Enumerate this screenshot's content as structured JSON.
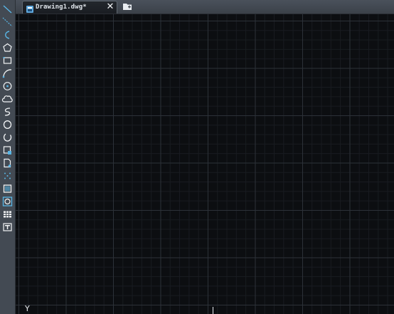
{
  "document_tab": {
    "label": "Drawing1.dwg*",
    "close_glyph": "✕",
    "icon": "dwg-file-icon"
  },
  "tab_bar": {
    "menu_icon": "chevron-down-icon",
    "new_tab_icon": "new-drawing-icon"
  },
  "tool_palette": {
    "items": [
      {
        "name": "line-tool",
        "icon": "line-icon"
      },
      {
        "name": "construction-line-tool",
        "icon": "xline-icon"
      },
      {
        "name": "polyline-tool",
        "icon": "polyline-icon"
      },
      {
        "name": "polygon-tool",
        "icon": "polygon-icon"
      },
      {
        "name": "rectangle-tool",
        "icon": "rectangle-icon"
      },
      {
        "name": "arc-tool",
        "icon": "arc-icon"
      },
      {
        "name": "circle-tool",
        "icon": "circle-icon"
      },
      {
        "name": "revision-cloud-tool",
        "icon": "cloud-icon"
      },
      {
        "name": "spline-tool",
        "icon": "spline-icon"
      },
      {
        "name": "ellipse-tool",
        "icon": "ellipse-icon"
      },
      {
        "name": "ellipse-arc-tool",
        "icon": "ellipse-arc-icon"
      },
      {
        "name": "insert-block-tool",
        "icon": "insert-block-icon"
      },
      {
        "name": "make-block-tool",
        "icon": "make-block-icon"
      },
      {
        "name": "point-tool",
        "icon": "point-icon"
      },
      {
        "name": "hatch-tool",
        "icon": "hatch-icon"
      },
      {
        "name": "region-tool",
        "icon": "region-icon"
      },
      {
        "name": "table-tool",
        "icon": "table-icon"
      },
      {
        "name": "multiline-text-tool",
        "icon": "mtext-icon"
      }
    ]
  },
  "canvas": {
    "ucs_axis_label": "Y",
    "colors": {
      "background": "#0c0e11",
      "major_grid": "#2c3138",
      "minor_grid": "#181b20",
      "tool_accent": "#59b6e6"
    }
  }
}
